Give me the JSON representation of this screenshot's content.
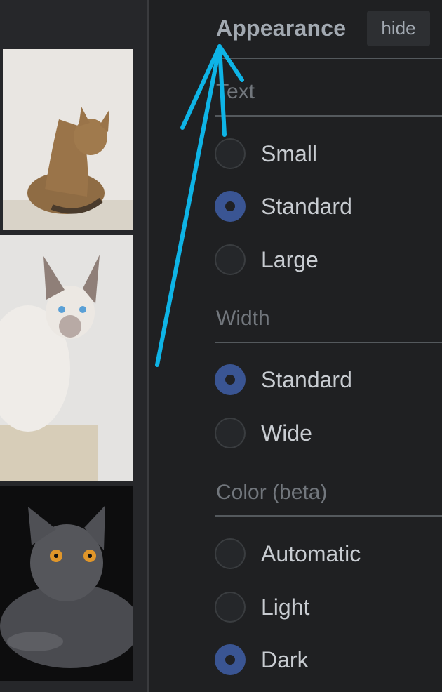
{
  "panel": {
    "title": "Appearance",
    "hide_label": "hide"
  },
  "sections": {
    "text": {
      "label": "Text",
      "options": [
        {
          "label": "Small",
          "checked": false
        },
        {
          "label": "Standard",
          "checked": true
        },
        {
          "label": "Large",
          "checked": false
        }
      ]
    },
    "width": {
      "label": "Width",
      "options": [
        {
          "label": "Standard",
          "checked": true
        },
        {
          "label": "Wide",
          "checked": false
        }
      ]
    },
    "color": {
      "label": "Color (beta)",
      "options": [
        {
          "label": "Automatic",
          "checked": false
        },
        {
          "label": "Light",
          "checked": false
        },
        {
          "label": "Dark",
          "checked": true
        }
      ]
    }
  },
  "thumbnails": [
    {
      "subject": "abyssinian-cat"
    },
    {
      "subject": "siamese-cat"
    },
    {
      "subject": "british-shorthair-cat"
    }
  ],
  "colors": {
    "background": "#1f2022",
    "title": "#a2a9b1",
    "section_label": "#72777d",
    "option_label": "#c8ccd1",
    "radio_checked": "#3a5593",
    "annotation_arrow": "#0eb4e6"
  }
}
